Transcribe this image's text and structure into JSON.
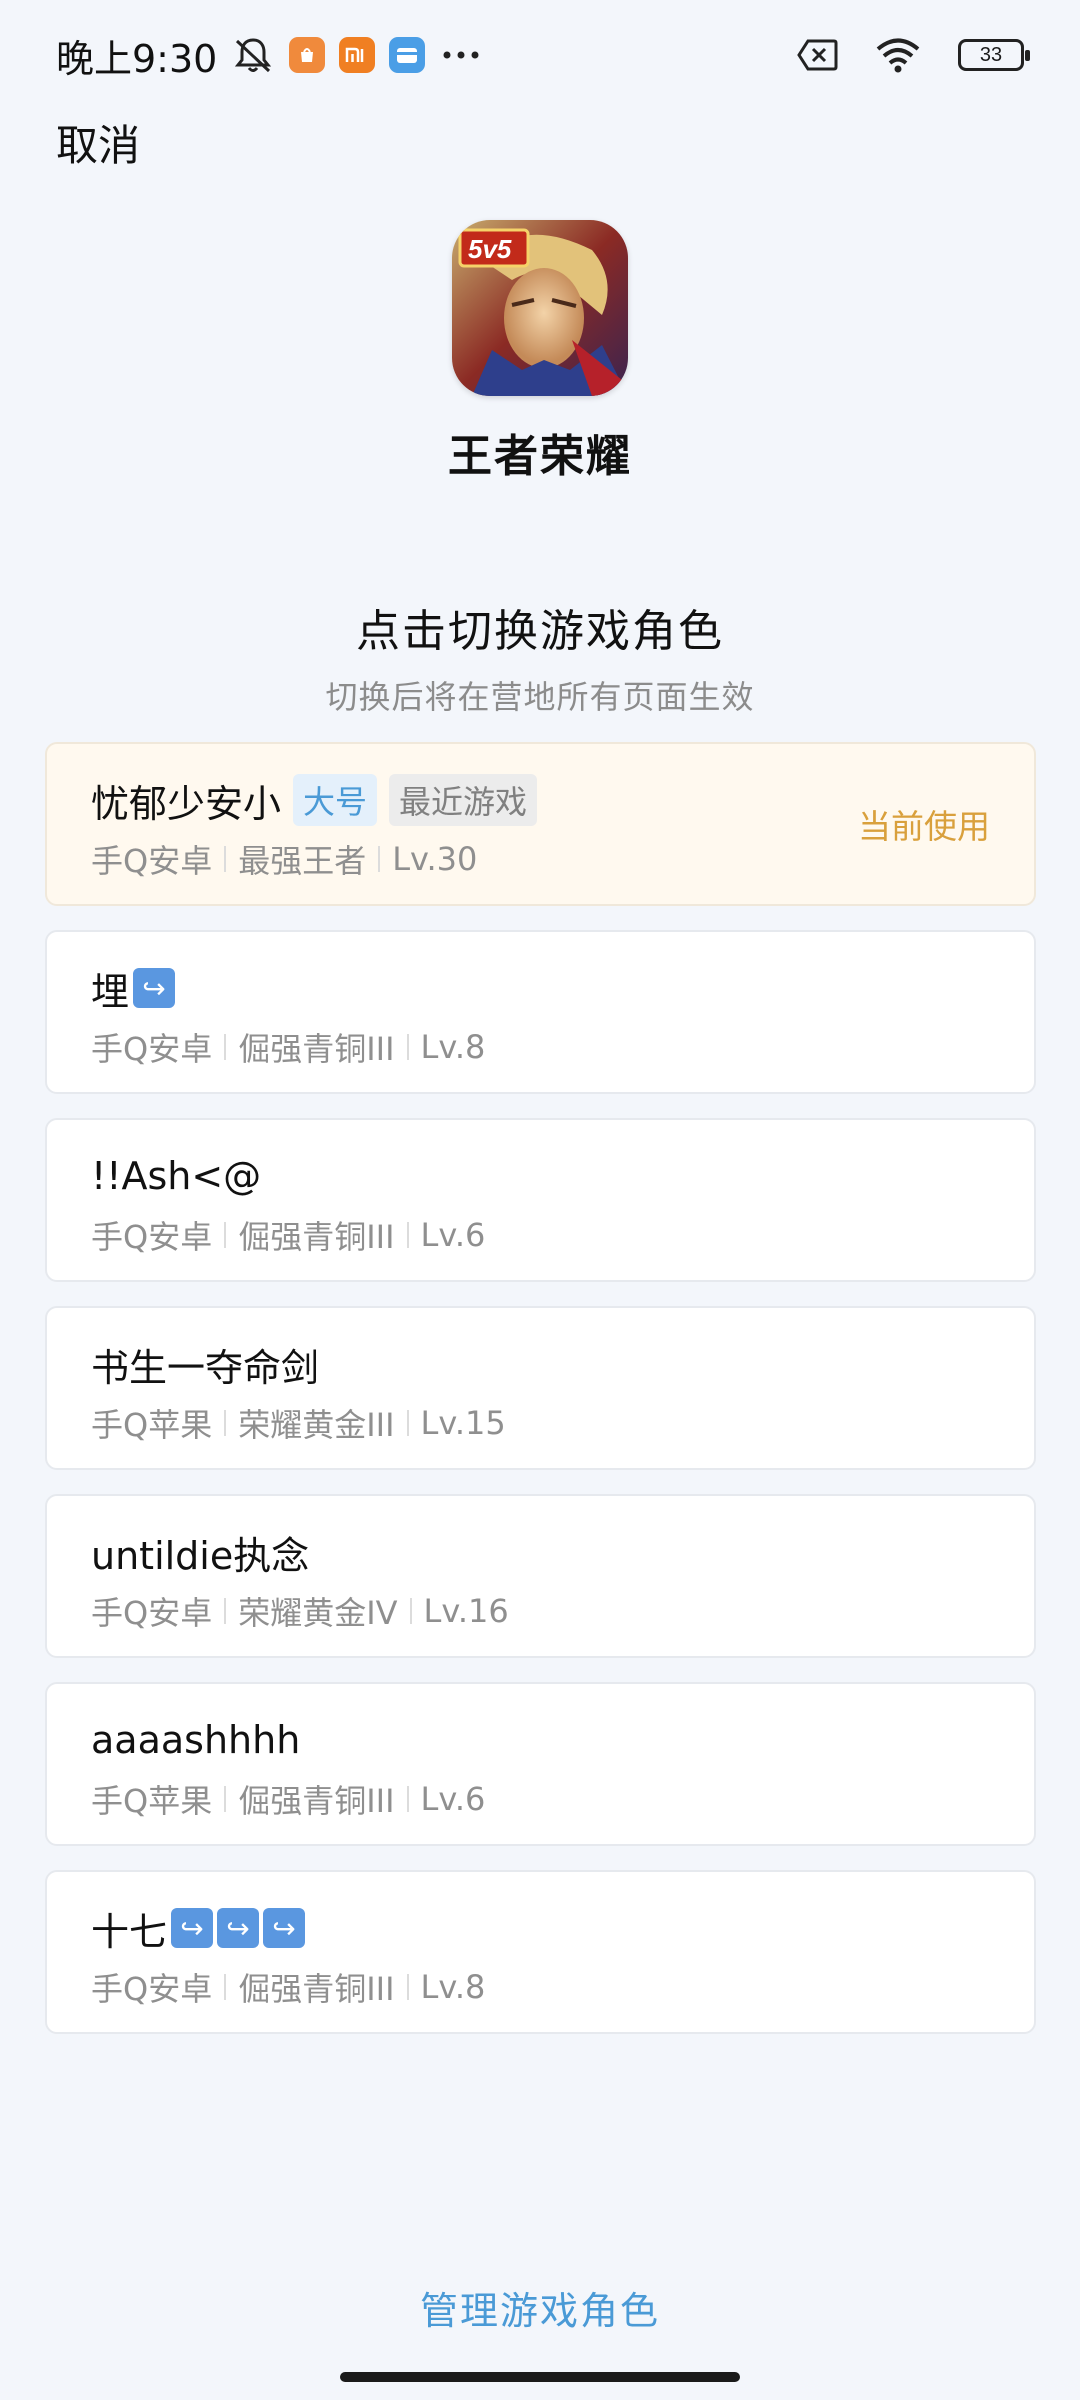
{
  "status_bar": {
    "time": "晚上9:30",
    "battery": "33",
    "icons": [
      "mute-bell-icon",
      "mi-store-icon",
      "mi-app-icon",
      "wallet-icon",
      "more-dots-icon",
      "sim-off-icon",
      "wifi-icon",
      "battery-icon"
    ],
    "colors": {
      "mi_store": "#f08a3c",
      "mi_app": "#f07f22",
      "wallet": "#4a9ee6"
    }
  },
  "header": {
    "cancel": "取消",
    "game_name": "王者荣耀",
    "game_icon_badge": "5v5"
  },
  "section": {
    "title": "点击切换游戏角色",
    "subtitle": "切换后将在营地所有页面生效"
  },
  "roles": [
    {
      "name": "忧郁少安小",
      "tags": [
        "大号",
        "最近游戏"
      ],
      "platform": "手Q安卓",
      "rank": "最强王者",
      "level": "Lv.30",
      "status": "当前使用"
    },
    {
      "name": "埋",
      "emoji_count": 1,
      "platform": "手Q安卓",
      "rank": "倔强青铜III",
      "level": "Lv.8"
    },
    {
      "name": "!!Ash<@",
      "platform": "手Q安卓",
      "rank": "倔强青铜III",
      "level": "Lv.6"
    },
    {
      "name": "书生一夺命剑",
      "platform": "手Q苹果",
      "rank": "荣耀黄金III",
      "level": "Lv.15"
    },
    {
      "name": "untildie执念",
      "platform": "手Q安卓",
      "rank": "荣耀黄金IV",
      "level": "Lv.16"
    },
    {
      "name": "aaaashhhh",
      "platform": "手Q苹果",
      "rank": "倔强青铜III",
      "level": "Lv.6"
    },
    {
      "name": "十七",
      "emoji_count": 3,
      "platform": "手Q安卓",
      "rank": "倔强青铜III",
      "level": "Lv.8"
    }
  ],
  "footer": {
    "manage": "管理游戏角色"
  },
  "colors": {
    "accent": "#4a9ad6",
    "current": "#d9a03c",
    "current_bg": "#fff9ef",
    "background": "#f3f6fb"
  }
}
